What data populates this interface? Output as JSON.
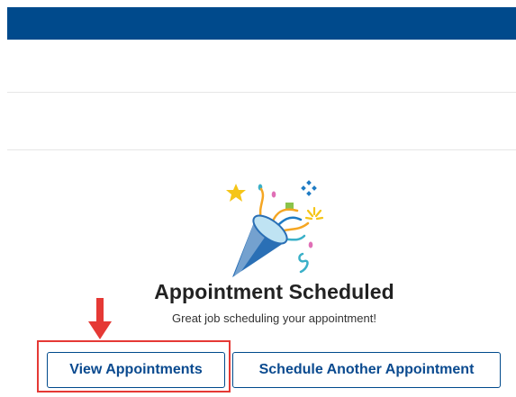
{
  "header": {
    "color": "#004a8c"
  },
  "confirmation": {
    "illustration_icon": "party-popper-icon",
    "title": "Appointment Scheduled",
    "subtitle": "Great job scheduling your appointment!"
  },
  "actions": {
    "view_label": "View Appointments",
    "schedule_label": "Schedule Another Appointment"
  },
  "annotation": {
    "arrow_color": "#e53935",
    "highlight_color": "#e53935"
  }
}
